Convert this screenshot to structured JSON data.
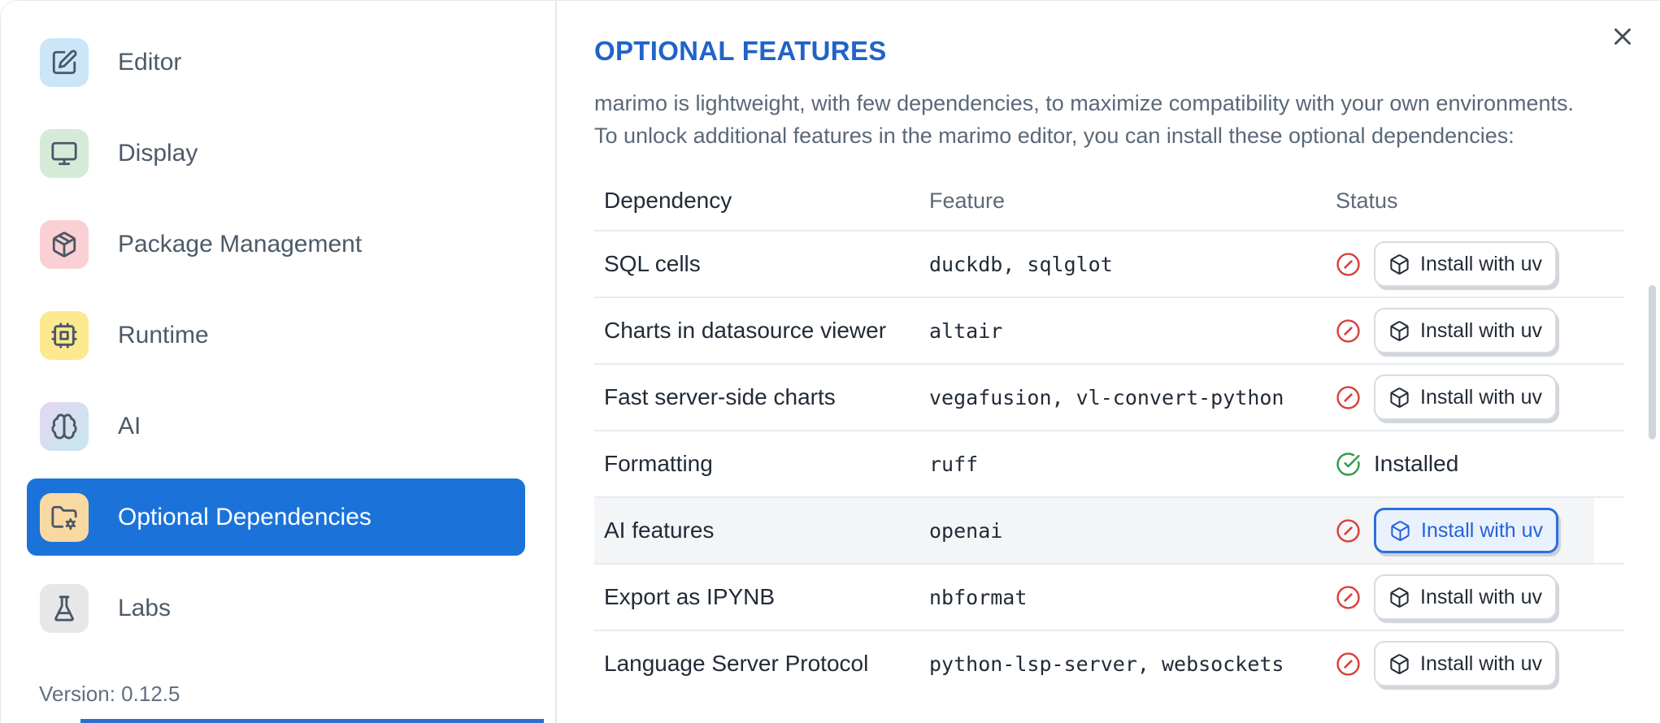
{
  "sidebar": {
    "items": [
      {
        "label": "Editor",
        "icon": "edit-icon"
      },
      {
        "label": "Display",
        "icon": "monitor-icon"
      },
      {
        "label": "Package Management",
        "icon": "package-icon"
      },
      {
        "label": "Runtime",
        "icon": "cpu-icon"
      },
      {
        "label": "AI",
        "icon": "brain-icon"
      },
      {
        "label": "Optional Dependencies",
        "icon": "folder-cog-icon",
        "selected": true
      },
      {
        "label": "Labs",
        "icon": "flask-icon"
      }
    ],
    "version_label": "Version: 0.12.5"
  },
  "main": {
    "title": "OPTIONAL FEATURES",
    "description_lines": [
      "marimo is lightweight, with few dependencies, to maximize compatibility with your own environments.",
      "To unlock additional features in the marimo editor, you can install these optional dependencies:"
    ],
    "table": {
      "headers": [
        "Dependency",
        "Feature",
        "Status"
      ],
      "install_button_label": "Install with uv",
      "installed_label": "Installed",
      "missing_icon": "circle-x-icon",
      "installed_icon": "circle-check-icon",
      "button_icon": "package-box-icon",
      "rows": [
        {
          "dependency": "SQL cells",
          "feature": "duckdb, sqlglot",
          "status": "missing"
        },
        {
          "dependency": "Charts in datasource viewer",
          "feature": "altair",
          "status": "missing"
        },
        {
          "dependency": "Fast server-side charts",
          "feature": "vegafusion, vl-convert-python",
          "status": "missing"
        },
        {
          "dependency": "Formatting",
          "feature": "ruff",
          "status": "installed"
        },
        {
          "dependency": "AI features",
          "feature": "openai",
          "status": "missing",
          "highlighted": true,
          "button_focused": true
        },
        {
          "dependency": "Export as IPYNB",
          "feature": "nbformat",
          "status": "missing"
        },
        {
          "dependency": "Language Server Protocol",
          "feature": "python-lsp-server, websockets",
          "status": "missing"
        }
      ]
    }
  },
  "colors": {
    "selected_item_blue": "#1b73da",
    "title_blue": "#2163c8",
    "focus_button_blue": "#2d6fdb",
    "error_red": "#d8403c",
    "success_green": "#2f9e44"
  }
}
